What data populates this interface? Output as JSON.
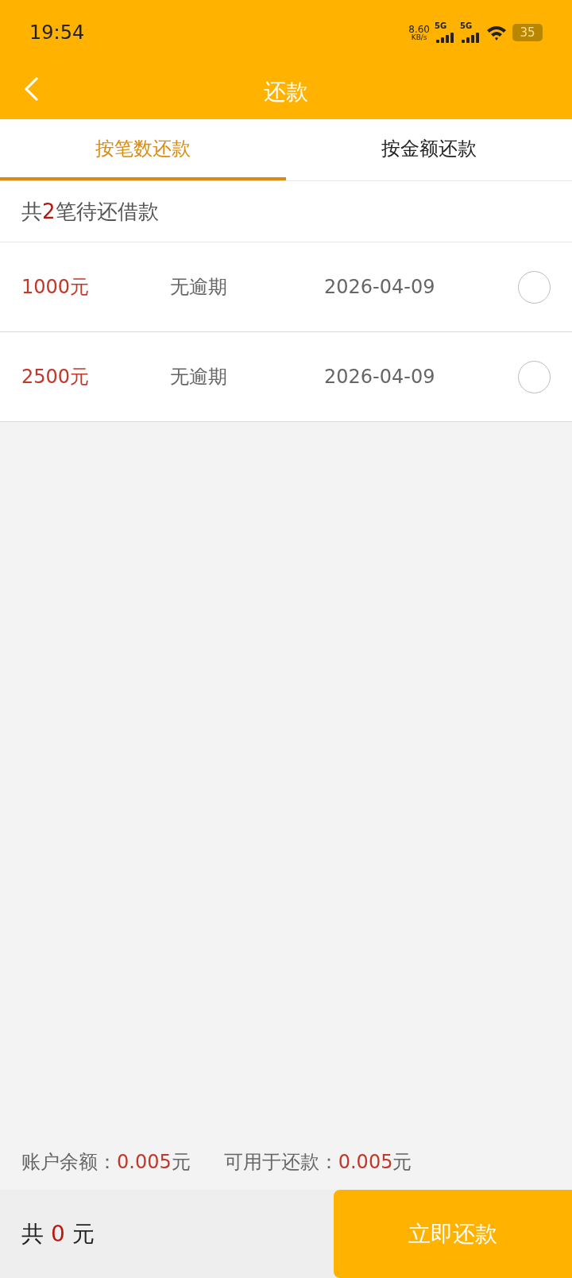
{
  "status_bar": {
    "time": "19:54",
    "speed": "8.60",
    "speed_unit": "KB/s",
    "sim1": "5G",
    "sim2": "5G",
    "battery": "35"
  },
  "header": {
    "title": "还款"
  },
  "tabs": [
    {
      "label": "按笔数还款",
      "selected": true
    },
    {
      "label": "按金额还款",
      "selected": false
    }
  ],
  "summary": {
    "prefix": "共",
    "count": "2",
    "suffix": "笔待还借款"
  },
  "loans": [
    {
      "amount": "1000元",
      "status": "无逾期",
      "date": "2026-04-09",
      "selected": false
    },
    {
      "amount": "2500元",
      "status": "无逾期",
      "date": "2026-04-09",
      "selected": false
    }
  ],
  "balance": {
    "label": "账户余额：",
    "value": "0.005",
    "unit": "元"
  },
  "available": {
    "label": "可用于还款：",
    "value": "0.005",
    "unit": "元"
  },
  "total": {
    "prefix": "共",
    "value": "0",
    "unit": "元"
  },
  "pay_button": "立即还款"
}
